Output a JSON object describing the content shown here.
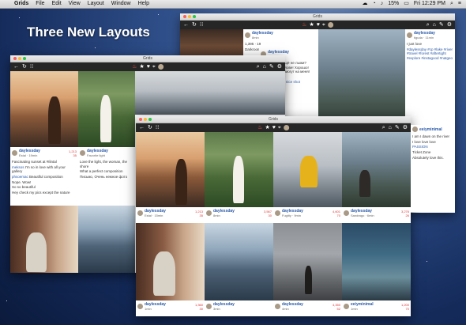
{
  "menubar": {
    "apple": "",
    "app_name": "Grids",
    "menus": [
      "File",
      "Edit",
      "View",
      "Layout",
      "Window",
      "Help"
    ],
    "battery": "15%",
    "clock": "Fri 12:29 PM"
  },
  "headline": "Three New Layouts",
  "window_title": "Grids",
  "toolbar_icons": {
    "left": [
      "back-icon",
      "refresh-icon",
      "grid-icon"
    ],
    "center": [
      "fire-icon",
      "star-icon",
      "heart-icon",
      "pin-icon",
      "avatar"
    ],
    "right": [
      "search-icon",
      "tag-icon",
      "pen-icon",
      "settings-icon"
    ]
  },
  "back_window": {
    "post1": {
      "user": "daylessday",
      "meta": "8min",
      "likes": "1,395",
      "comments": "19",
      "text": "Darkroom"
    },
    "post2": {
      "user": "daylessday",
      "meta": "8min",
      "text": "Бабулик мой ещё не лыжи? Какие вы по голове! Хорошо! Они ничего не могут на меня! Так красиво 🎉",
      "tag": "So amazing 🎉 nice shot"
    },
    "post3": {
      "user": "daylessday",
      "meta": "tiguda · 11min",
      "text": "I just love",
      "hashtags": "#daylessday #cp #lake #river #travel #forest #aftertight #explore #instagood #natgeo"
    }
  },
  "middle_window": {
    "post": {
      "user": "daylessday",
      "meta": "Estal · 19min",
      "likes": "1,213",
      "comments": "35",
      "text": "Fascinating sunset at #Ilintal",
      "comment1": "I'm so in love with all your gallery",
      "comment2": "Beautiful composition",
      "comment3": "Nope. Wow!",
      "comment4": "So so beautiful",
      "comment5": "Hey check my pics except the nature"
    },
    "post2": {
      "user": "daylessday",
      "meta": "Favorite light",
      "text": "Love the light, the woman, the shore",
      "comment1": "What a perfect composition",
      "comment2": "Письмо, Очень нежное фото"
    }
  },
  "front_window": {
    "cards": [
      {
        "user": "daylessday",
        "meta": "Estal · 15min",
        "likes": "1,213",
        "comments": "35"
      },
      {
        "user": "daylessday",
        "meta": "8min",
        "likes": "3,567",
        "comments": "30"
      },
      {
        "user": "daylessday",
        "meta": "Fugitiy · 9min",
        "likes": "4,601",
        "comments": "70"
      },
      {
        "user": "daylessday",
        "meta": "Sandrago · 6min",
        "likes": "3,276",
        "comments": "26"
      },
      {
        "user": "daylessday",
        "meta": "1min",
        "likes": "1,360",
        "comments": "30"
      },
      {
        "user": "daylessday",
        "meta": "3min",
        "likes": "",
        "comments": ""
      },
      {
        "user": "daylessday",
        "meta": "4min",
        "likes": "4,350",
        "comments": "52"
      },
      {
        "user": "eeiyminimal",
        "meta": "1min",
        "likes": "1,200",
        "comments": "70"
      }
    ],
    "side_user": "eeiyminimal",
    "side_text1": "I am I dawn on the river",
    "side_text2": "I love love love",
    "side_hl": "PASSION",
    "side_text3": "Ticket Zone",
    "side_text4": "Absolutely love this."
  }
}
